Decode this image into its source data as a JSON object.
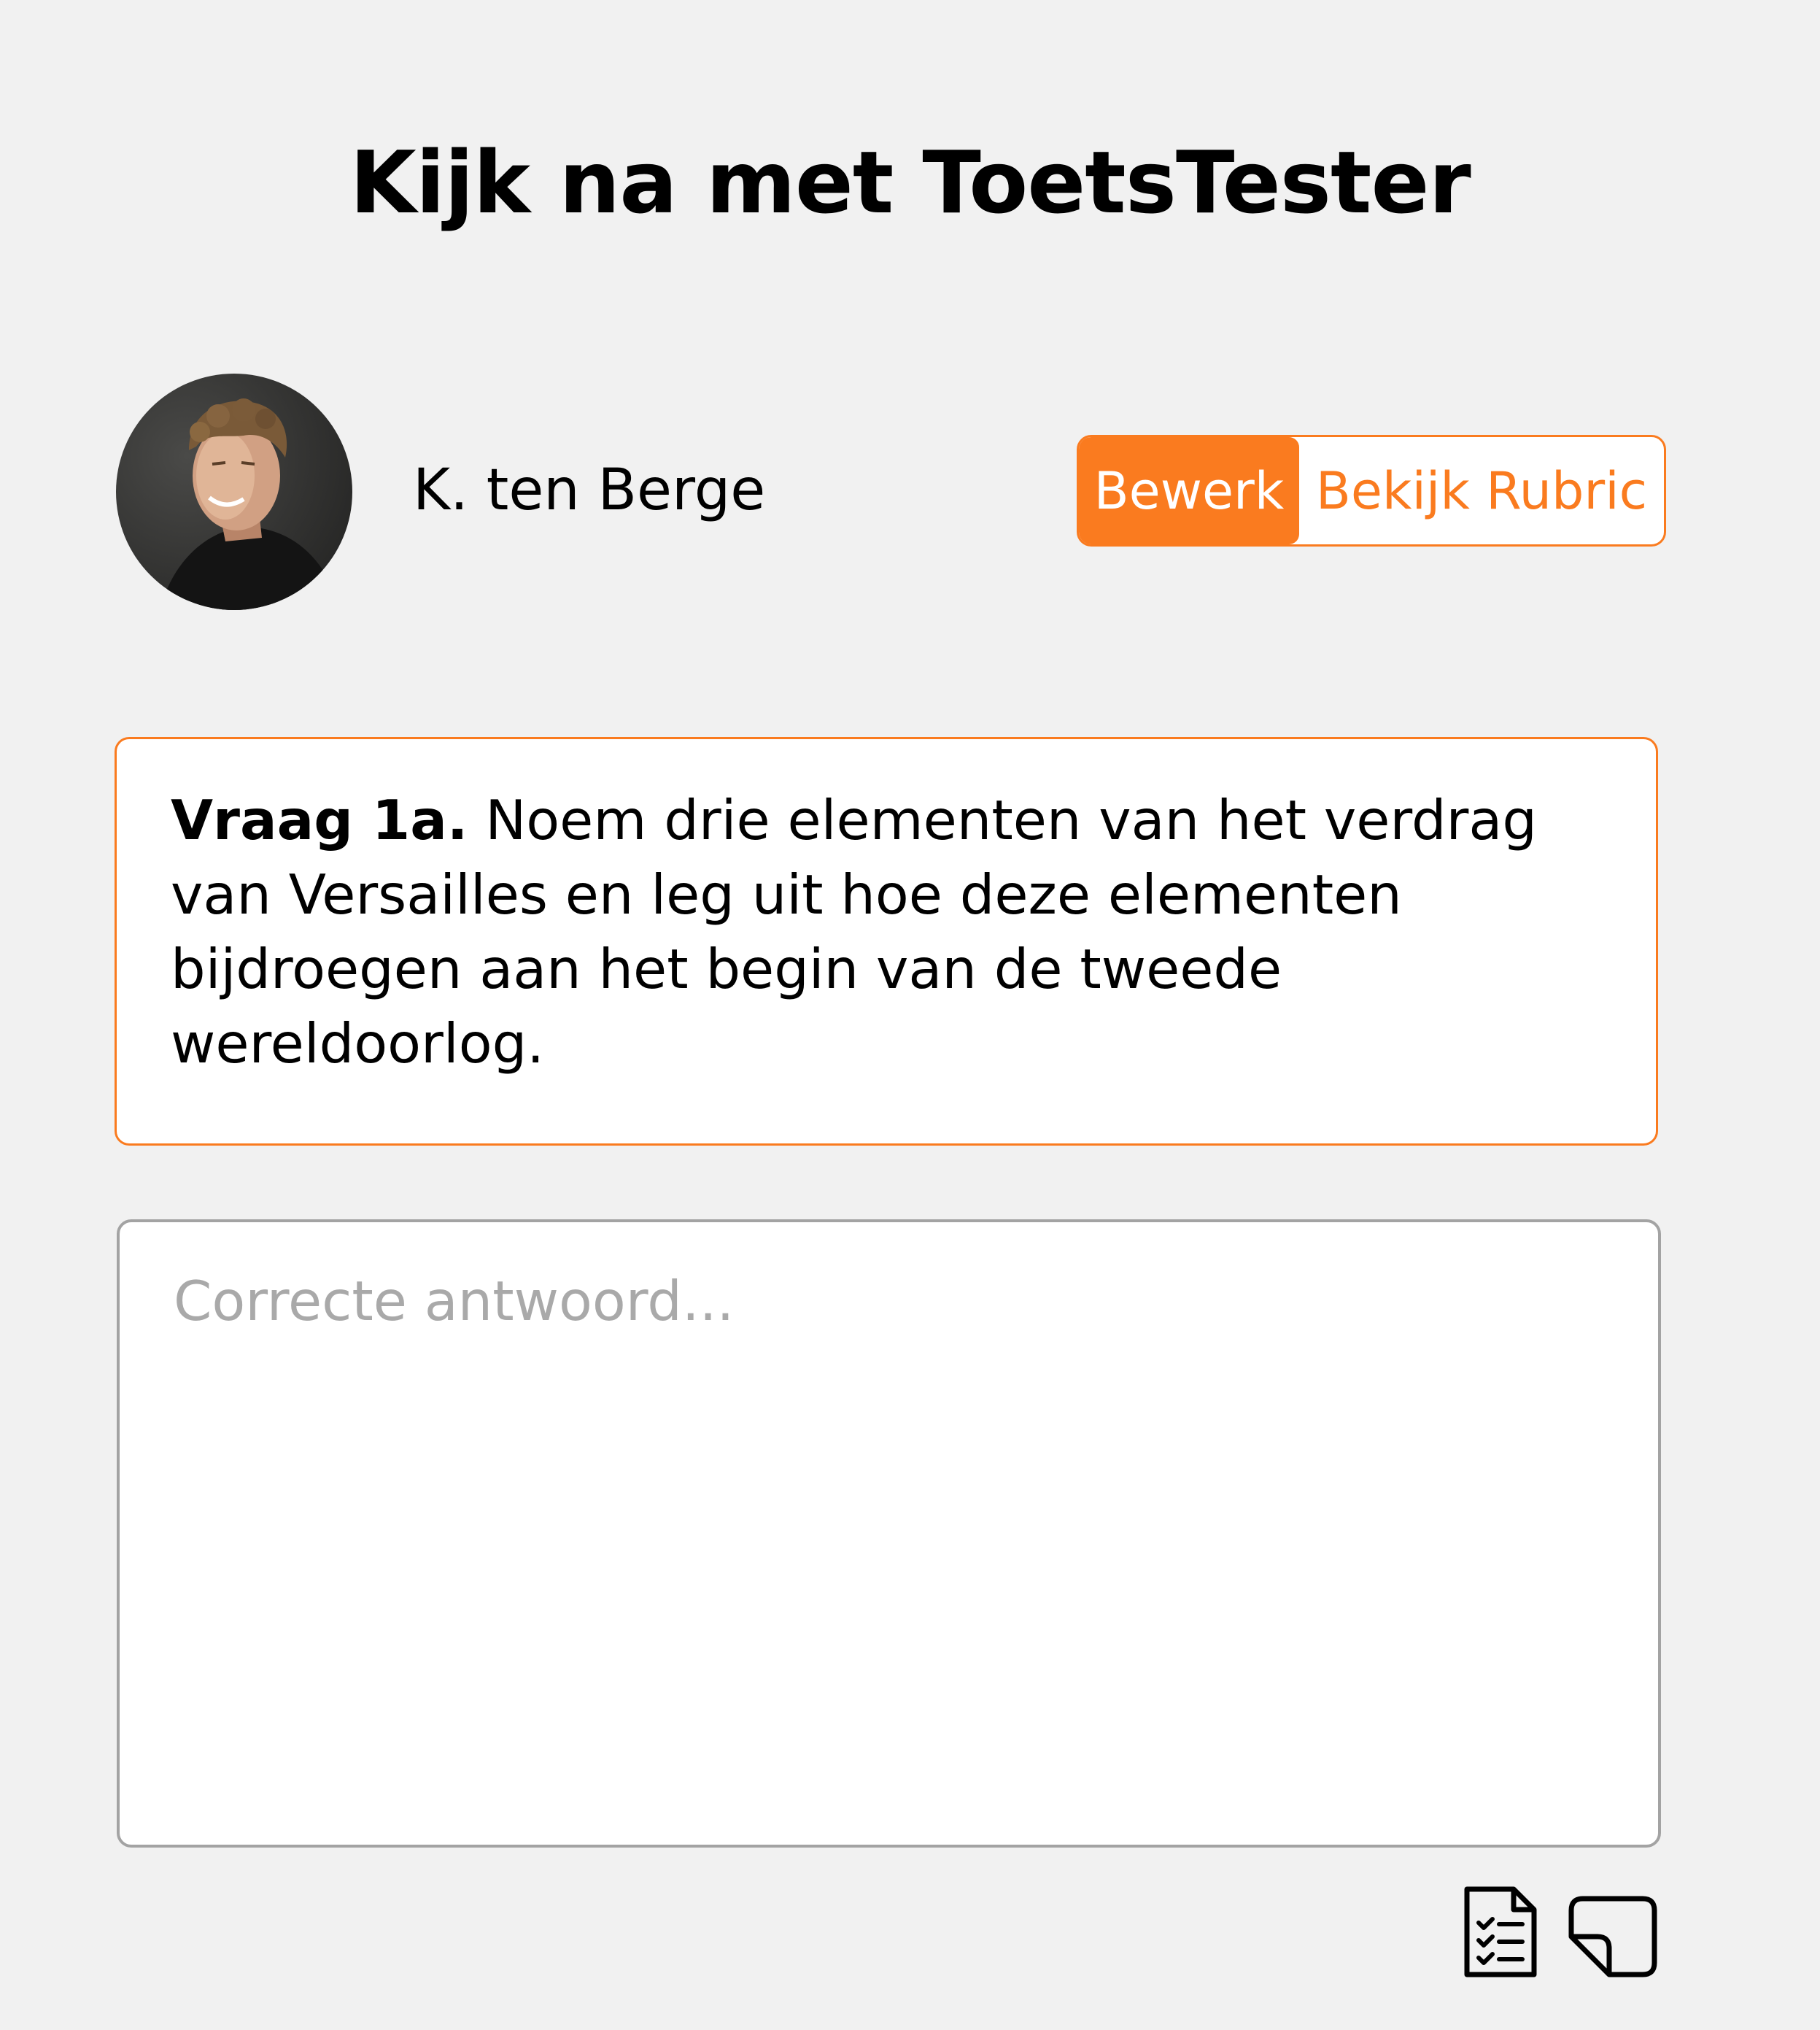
{
  "header": {
    "title": "Kijk na met ToetsTester"
  },
  "user": {
    "name": "K. ten Berge",
    "avatar_icon": "user-photo"
  },
  "mode_toggle": {
    "edit_label": "Bewerk",
    "rubric_label": "Bekijk Rubric",
    "active": "edit"
  },
  "question": {
    "number_label": "Vraag 1a.",
    "text": "Noem drie elementen van het verdrag van Versailles en leg uit hoe deze elementen bijdroegen aan het begin van de tweede wereldoorlog."
  },
  "answer": {
    "value": "",
    "placeholder": "Correcte antwoord..."
  },
  "toolbar": {
    "checklist_icon": "checklist-document-icon",
    "note_icon": "sticky-note-icon"
  },
  "colors": {
    "accent": "#fa7b1f",
    "background": "#f1f1f1",
    "border_gray": "#a3a3a3"
  }
}
